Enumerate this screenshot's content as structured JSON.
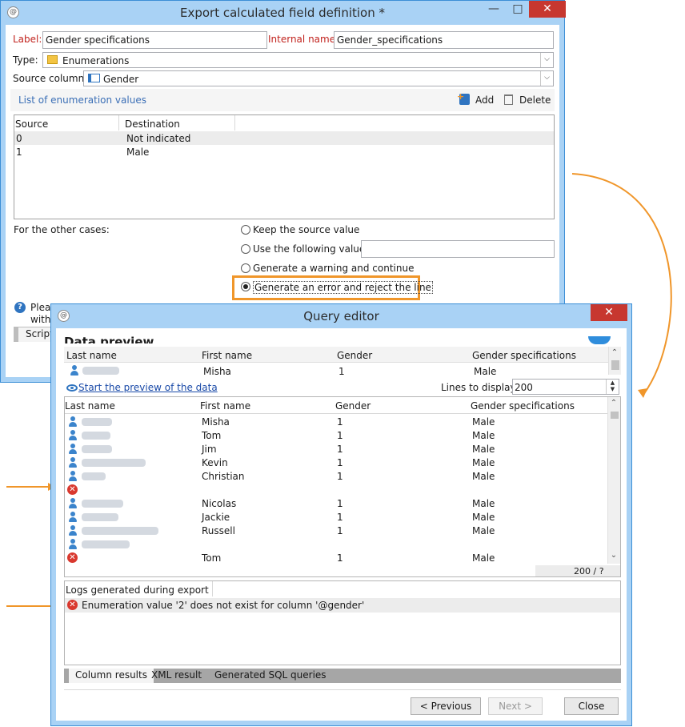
{
  "export_window": {
    "title": "Export calculated field definition *",
    "label_caption": "Label:",
    "label_value": "Gender specifications",
    "internal_name_caption": "Internal name:",
    "internal_name_value": "Gender_specifications",
    "type_caption": "Type:",
    "type_value": "Enumerations",
    "source_column_caption": "Source column:",
    "source_column_value": "Gender",
    "enum_section_title": "List of enumeration values",
    "add_label": "Add",
    "delete_label": "Delete",
    "enum_table": {
      "columns": [
        "Source",
        "Destination"
      ],
      "rows": [
        {
          "source": "0",
          "destination": "Not indicated"
        },
        {
          "source": "1",
          "destination": "Male"
        }
      ]
    },
    "other_cases_caption": "For the other cases:",
    "radio_options": [
      {
        "label": "Keep the source value",
        "selected": false
      },
      {
        "label": "Use the following value:",
        "selected": false
      },
      {
        "label": "Generate a warning and continue",
        "selected": false
      },
      {
        "label": "Generate an error and reject the line",
        "selected": true
      }
    ],
    "info_text_line1": "Pleas",
    "info_text_line2": "with",
    "script_tab_label": "Script"
  },
  "query_window": {
    "title": "Query editor",
    "heading": "Data preview",
    "top_table": {
      "columns": [
        "Last name",
        "First name",
        "Gender",
        "Gender specifications"
      ],
      "row": {
        "first_name": "Misha",
        "gender": "1",
        "gender_spec": "Male"
      }
    },
    "preview_link": "Start the preview of the data",
    "lines_caption": "Lines to display:",
    "lines_value": "200",
    "results_table": {
      "columns": [
        "Last name",
        "First name",
        "Gender",
        "Gender specifications"
      ],
      "rows": [
        {
          "status": "ok",
          "first_name": "Misha",
          "gender": "1",
          "gender_spec": "Male"
        },
        {
          "status": "ok",
          "first_name": "Tom",
          "gender": "1",
          "gender_spec": "Male"
        },
        {
          "status": "ok",
          "first_name": "Jim",
          "gender": "1",
          "gender_spec": "Male"
        },
        {
          "status": "ok",
          "first_name": "Kevin",
          "gender": "1",
          "gender_spec": "Male"
        },
        {
          "status": "ok",
          "first_name": "Christian",
          "gender": "1",
          "gender_spec": "Male"
        },
        {
          "status": "error",
          "first_name": "",
          "gender": "",
          "gender_spec": ""
        },
        {
          "status": "ok",
          "first_name": "Nicolas",
          "gender": "1",
          "gender_spec": "Male"
        },
        {
          "status": "ok",
          "first_name": "Jackie",
          "gender": "1",
          "gender_spec": "Male"
        },
        {
          "status": "ok",
          "first_name": "Russell",
          "gender": "1",
          "gender_spec": "Male"
        },
        {
          "status": "ok",
          "first_name": "",
          "gender": "",
          "gender_spec": ""
        },
        {
          "status": "error",
          "first_name": "Tom",
          "gender": "1",
          "gender_spec": "Male"
        }
      ],
      "count_text": "200 / ?"
    },
    "logs_header": "Logs generated during export",
    "log_message": "Enumeration value '2' does not exist for column '@gender'",
    "tabs": [
      "Column results",
      "XML result",
      "Generated SQL queries"
    ],
    "previous_label": "< Previous",
    "next_label": "Next >",
    "close_label": "Close"
  },
  "colors": {
    "accent_orange": "#f0962a",
    "title_bar": "#a9d2f5",
    "close_red": "#c7372f",
    "error_red": "#d9382e"
  }
}
